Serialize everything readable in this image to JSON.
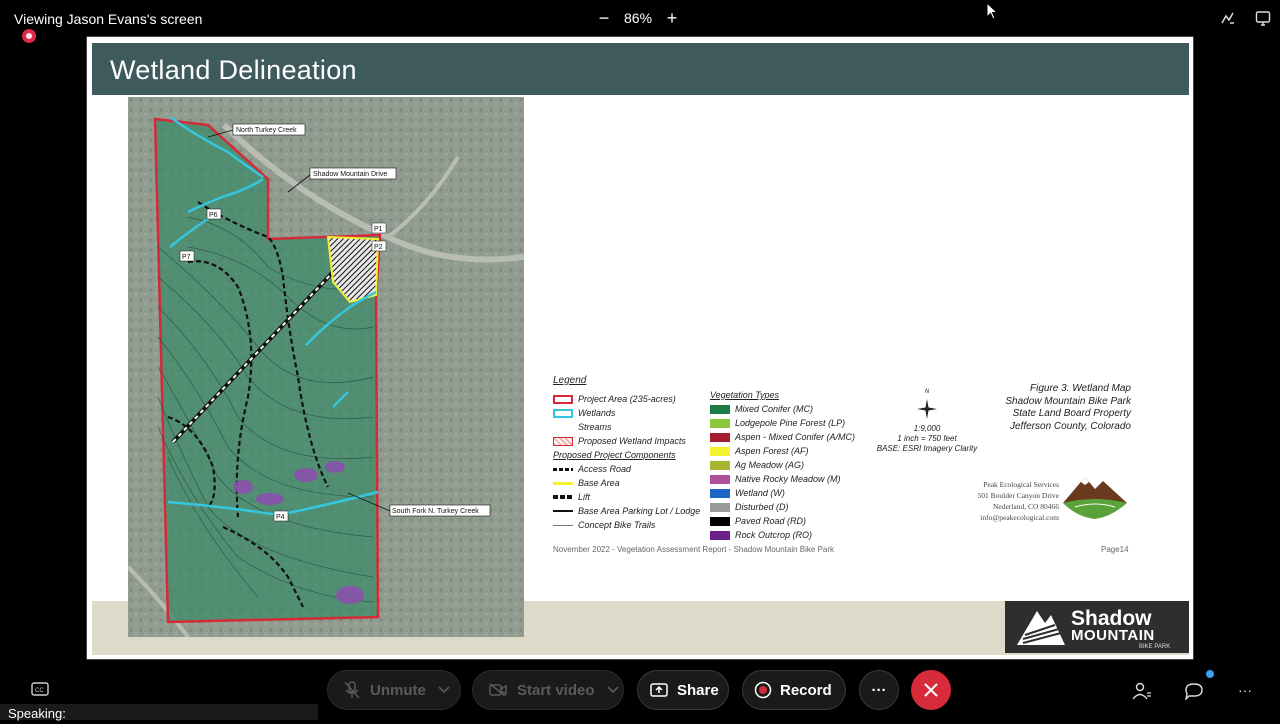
{
  "topbar": {
    "viewing_label": "Viewing Jason Evans's screen",
    "zoom_out": "−",
    "zoom_level": "86%",
    "zoom_in": "+"
  },
  "slide": {
    "title": "Wetland Delineation",
    "map_labels": {
      "north_turkey_creek": "North Turkey Creek",
      "shadow_mountain_drive": "Shadow Mountain Drive",
      "south_fork": "South Fork N. Turkey Creek",
      "p1": "P1",
      "p2": "P2",
      "p4": "P4",
      "p6": "P6",
      "p7": "P7"
    },
    "legend": {
      "title": "Legend",
      "left_items": [
        {
          "label": "Project Area (235-acres)",
          "symbol": "red-outline"
        },
        {
          "label": "Wetlands",
          "symbol": "cyan-outline"
        },
        {
          "label": "Streams",
          "symbol": "none"
        },
        {
          "label": "Proposed Wetland Impacts",
          "symbol": "red-hatch"
        }
      ],
      "components_title": "Proposed Project Components",
      "components": [
        {
          "label": "Access Road",
          "symbol": "dashed"
        },
        {
          "label": "Base Area",
          "symbol": "yellow-line"
        },
        {
          "label": "Lift",
          "symbol": "lift"
        },
        {
          "label": "Base Area Parking Lot / Lodge",
          "symbol": "solid"
        },
        {
          "label": "Concept Bike Trails",
          "symbol": "thin"
        }
      ],
      "veg_title": "Vegetation Types",
      "vegetation": [
        {
          "label": "Mixed Conifer (MC)",
          "color": "#1f7a4a"
        },
        {
          "label": "Lodgepole Pine Forest (LP)",
          "color": "#8cc63f"
        },
        {
          "label": "Aspen - Mixed Conifer (A/MC)",
          "color": "#a31d2e"
        },
        {
          "label": "Aspen Forest (AF)",
          "color": "#f2f231"
        },
        {
          "label": "Ag Meadow (AG)",
          "color": "#a9b430"
        },
        {
          "label": "Native Rocky Meadow (M)",
          "color": "#b04f9e"
        },
        {
          "label": "Wetland (W)",
          "color": "#1f63c4"
        },
        {
          "label": "Disturbed (D)",
          "color": "#9a9a9a"
        },
        {
          "label": "Paved Road (RD)",
          "color": "#000000"
        },
        {
          "label": "Rock Outcrop (RO)",
          "color": "#6a1f8a"
        }
      ]
    },
    "scale": {
      "north": "N",
      "ratio": "1:9,000",
      "inch": "1 inch = 750 feet",
      "base": "BASE: ESRI Imagery Clarity"
    },
    "figure": {
      "line1": "Figure 3. Wetland Map",
      "line2": "Shadow Mountain Bike Park",
      "line3": "State Land Board Property",
      "line4": "Jefferson County, Colorado"
    },
    "peak": {
      "line1": "Peak Ecological Services",
      "line2": "501 Boulder Canyon Drive",
      "line3": "Nederland, CO 80466",
      "line4": "info@peakecological.com"
    },
    "footer_left": "November 2022 - Vegetation Assessment Report - Shadow Mountain Bike Park",
    "footer_right": "Page14",
    "logo": {
      "line1": "Shadow",
      "line2": "MOUNTAIN",
      "line3": "BIKE PARK"
    }
  },
  "controls": {
    "unmute": "Unmute",
    "start_video": "Start video",
    "share": "Share",
    "record": "Record",
    "more": "···"
  },
  "speaking_label": "Speaking:",
  "colors": {
    "end_call": "#d72a3a",
    "title_bar": "#3e5a5c"
  }
}
